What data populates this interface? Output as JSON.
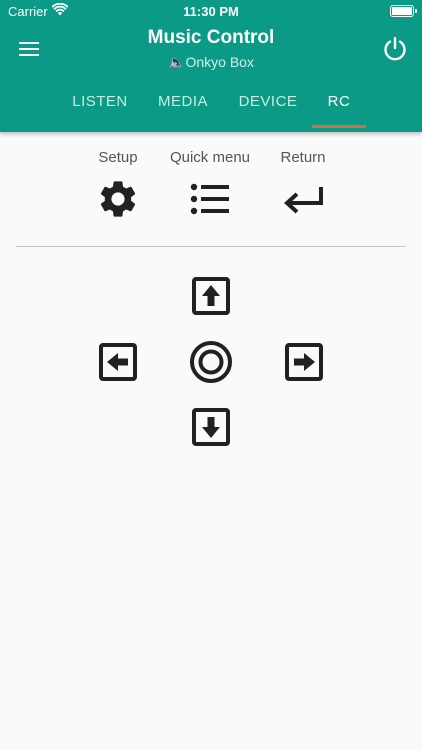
{
  "status_bar": {
    "carrier": "Carrier",
    "time": "11:30 PM"
  },
  "header": {
    "title": "Music Control",
    "subtitle": "🔈Onkyo Box"
  },
  "tabs": [
    {
      "label": "LISTEN"
    },
    {
      "label": "MEDIA"
    },
    {
      "label": "DEVICE"
    },
    {
      "label": "RC",
      "active": true
    }
  ],
  "remote": {
    "setup_label": "Setup",
    "quick_menu_label": "Quick menu",
    "return_label": "Return"
  },
  "icons": {
    "menu": "hamburger-menu-icon",
    "power": "power-icon",
    "setup": "gear-icon",
    "quick_menu": "list-icon",
    "return": "return-arrow-icon",
    "up": "arrow-up-box-icon",
    "left": "arrow-left-box-icon",
    "enter": "circle-enter-icon",
    "right": "arrow-right-box-icon",
    "down": "arrow-down-box-icon"
  },
  "colors": {
    "header_bg": "#0a9a86",
    "tab_indicator": "#e0683c",
    "icon": "#212121"
  }
}
